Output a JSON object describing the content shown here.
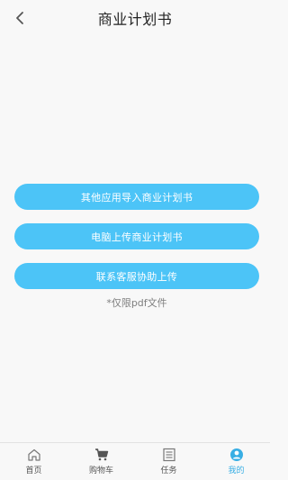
{
  "header": {
    "title": "商业计划书",
    "back_icon": "chevron-left-icon"
  },
  "actions": [
    {
      "label": "其他应用导入商业计划书"
    },
    {
      "label": "电脑上传商业计划书"
    },
    {
      "label": "联系客服协助上传"
    }
  ],
  "note": "*仅限pdf文件",
  "tabbar": [
    {
      "label": "首页",
      "icon": "home-icon",
      "active": false
    },
    {
      "label": "购物车",
      "icon": "cart-icon",
      "active": false
    },
    {
      "label": "任务",
      "icon": "list-icon",
      "active": false
    },
    {
      "label": "我的",
      "icon": "user-icon",
      "active": true
    }
  ],
  "colors": {
    "accent": "#4cc4f7",
    "active_tab": "#38aee4",
    "background": "#f8f8f8"
  }
}
